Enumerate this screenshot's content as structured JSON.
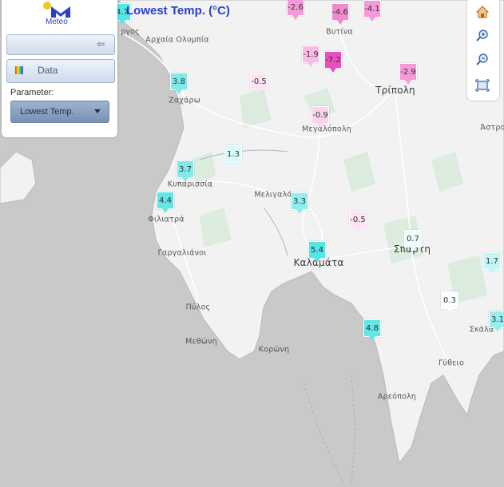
{
  "title": "Lowest Temp. (°C)",
  "logo_text": "Meteo",
  "panel": {
    "data_label": "Data",
    "parameter_label": "Parameter:",
    "parameter_value": "Lowest Temp."
  },
  "toolbar": {
    "buttons": [
      "home-icon",
      "zoom-in-icon",
      "zoom-out-icon",
      "zoom-extent-icon"
    ]
  },
  "colors": {
    "title": "#2a3fd1",
    "panel_button": "#cfdbec",
    "select": "#7891b4",
    "sea": "#c9c9c9",
    "land": "#f2f2f2",
    "forest": "#d6ead8",
    "road": "#ffffff"
  },
  "places": [
    {
      "name": "ργος",
      "big": false
    },
    {
      "name": "Αρχαία Ολυμπία",
      "big": false
    },
    {
      "name": "Ζαχάρω",
      "big": false
    },
    {
      "name": "Βυτίνα",
      "big": false
    },
    {
      "name": "Τρίπολη",
      "big": true
    },
    {
      "name": "Μεγαλόπολη",
      "big": false
    },
    {
      "name": "Άστρο",
      "big": false
    },
    {
      "name": "Κυπαρισσία",
      "big": false
    },
    {
      "name": "Μελιγαλάς",
      "big": false
    },
    {
      "name": "Φιλιατρά",
      "big": false
    },
    {
      "name": "Γαργαλιάνοι",
      "big": false
    },
    {
      "name": "Καλαμάτα",
      "big": true
    },
    {
      "name": "Σπάρτη",
      "big": true
    },
    {
      "name": "Πύλος",
      "big": false
    },
    {
      "name": "Μεθώνη",
      "big": false
    },
    {
      "name": "Κορώνη",
      "big": false
    },
    {
      "name": "Σκάλα",
      "big": false
    },
    {
      "name": "Γύθειο",
      "big": false
    },
    {
      "name": "Αρεόπολη",
      "big": false
    }
  ],
  "stations": [
    {
      "value": "4.7",
      "color": "#55e6e6"
    },
    {
      "value": "-2.6",
      "color": "#f59ad8"
    },
    {
      "value": "-4.6",
      "color": "#f08acf"
    },
    {
      "value": "-4.1",
      "color": "#f59ad8"
    },
    {
      "value": "-1.9",
      "color": "#f9bde5"
    },
    {
      "value": "-7.2",
      "color": "#e84fc0"
    },
    {
      "value": "-2.9",
      "color": "#f59ad8"
    },
    {
      "value": "3.8",
      "color": "#7eeaea"
    },
    {
      "value": "-0.5",
      "color": "#fde3f3"
    },
    {
      "value": "-0.9",
      "color": "#fbd3ee"
    },
    {
      "value": "1.3",
      "color": "#d8fafa"
    },
    {
      "value": "3.7",
      "color": "#7eeaea"
    },
    {
      "value": "4.4",
      "color": "#62e6e6"
    },
    {
      "value": "3.3",
      "color": "#8eeded"
    },
    {
      "value": "-0.5",
      "color": "#fde3f3"
    },
    {
      "value": "5.4",
      "color": "#55e6e6"
    },
    {
      "value": "0.7",
      "color": "#ebfcfc"
    },
    {
      "value": "1.7",
      "color": "#c0f6f6"
    },
    {
      "value": "0.3",
      "color": "#f8ffff"
    },
    {
      "value": "4.8",
      "color": "#62e6e6"
    },
    {
      "value": "3.1",
      "color": "#9aeded"
    }
  ]
}
